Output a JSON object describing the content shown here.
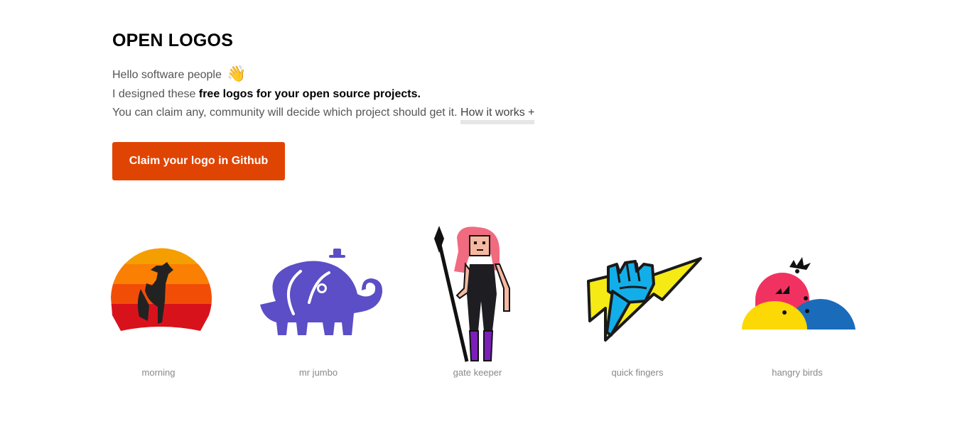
{
  "header": {
    "title": "OPEN LOGOS"
  },
  "intro": {
    "greeting": "Hello software people",
    "greeting_emoji": "👋",
    "line2_prefix": "I designed these ",
    "line2_bold": "free logos for your open source projects.",
    "line3_text": "You can claim any, community will decide which project should get it. ",
    "how_it_works_link": "How it works +"
  },
  "cta": {
    "label": "Claim your logo in Github",
    "color": "#e04403"
  },
  "logos": [
    {
      "caption": "morning",
      "icon": "rooster-sunrise-icon"
    },
    {
      "caption": "mr jumbo",
      "icon": "elephant-icon"
    },
    {
      "caption": "gate keeper",
      "icon": "warrior-with-spear-icon"
    },
    {
      "caption": "quick fingers",
      "icon": "fist-lightning-icon"
    },
    {
      "caption": "hangry birds",
      "icon": "angry-birds-icon"
    }
  ]
}
